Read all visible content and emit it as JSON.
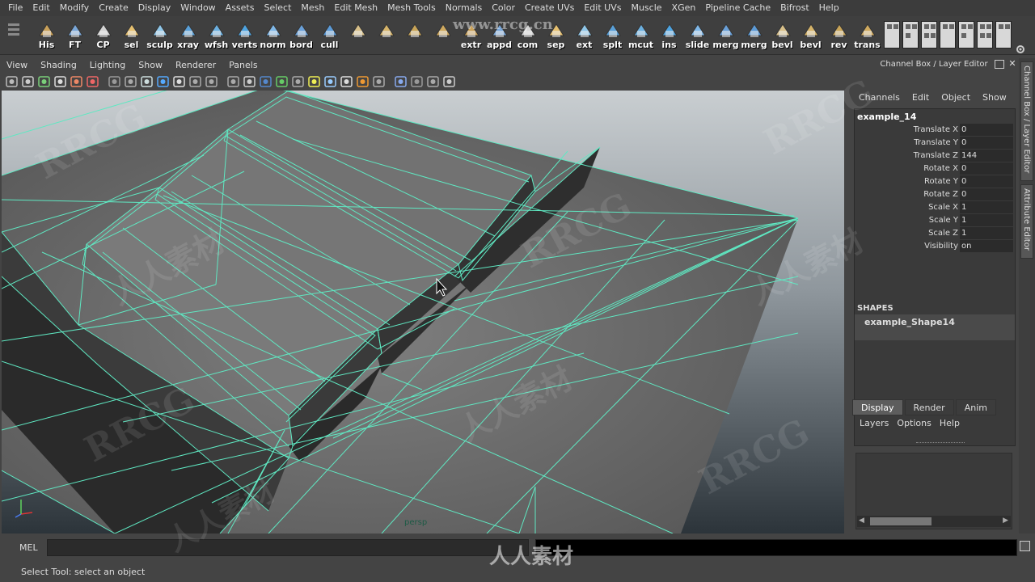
{
  "menubar": [
    "File",
    "Edit",
    "Modify",
    "Create",
    "Display",
    "Window",
    "Assets",
    "Select",
    "Mesh",
    "Edit Mesh",
    "Mesh Tools",
    "Normals",
    "Color",
    "Create UVs",
    "Edit UVs",
    "Muscle",
    "XGen",
    "Pipeline Cache",
    "Bifrost",
    "Help"
  ],
  "shelf": {
    "tools": [
      {
        "label": "His",
        "icon": "history-icon"
      },
      {
        "label": "FT",
        "icon": "freeze-transform-icon"
      },
      {
        "label": "CP",
        "icon": "center-pivot-icon"
      },
      {
        "label": "sel",
        "icon": "select-icon"
      },
      {
        "label": "sculp",
        "icon": "sculpt-icon"
      },
      {
        "label": "xray",
        "icon": "xray-icon"
      },
      {
        "label": "wfsh",
        "icon": "wireframe-shaded-icon"
      },
      {
        "label": "verts",
        "icon": "vertices-icon"
      },
      {
        "label": "norm",
        "icon": "normals-icon"
      },
      {
        "label": "bord",
        "icon": "border-edges-icon"
      },
      {
        "label": "cull",
        "icon": "backface-cull-icon"
      },
      {
        "label": "",
        "icon": "poly-plane-icon"
      },
      {
        "label": "",
        "icon": "poly-cube-icon"
      },
      {
        "label": "",
        "icon": "poly-sphere-icon"
      },
      {
        "label": "",
        "icon": "poly-cylinder-icon"
      },
      {
        "label": "extr",
        "icon": "extrude-icon"
      },
      {
        "label": "appd",
        "icon": "append-icon"
      },
      {
        "label": "com",
        "icon": "combine-icon"
      },
      {
        "label": "sep",
        "icon": "separate-icon"
      },
      {
        "label": "ext",
        "icon": "extract-icon"
      },
      {
        "label": "splt",
        "icon": "split-icon"
      },
      {
        "label": "mcut",
        "icon": "multi-cut-icon"
      },
      {
        "label": "ins",
        "icon": "insert-loop-icon"
      },
      {
        "label": "slide",
        "icon": "slide-edge-icon"
      },
      {
        "label": "merg",
        "icon": "merge-icon"
      },
      {
        "label": "merg",
        "icon": "merge-to-center-icon"
      },
      {
        "label": "bevl",
        "icon": "bevel-icon"
      },
      {
        "label": "bevl",
        "icon": "bevel-plus-icon"
      },
      {
        "label": "rev",
        "icon": "reverse-normals-icon"
      },
      {
        "label": "trans",
        "icon": "transfer-icon"
      }
    ],
    "layout_buttons": [
      "single-pane-icon",
      "four-pane-icon",
      "two-pane-side-icon",
      "two-pane-stacked-icon",
      "three-pane-icon",
      "outliner-pane-icon",
      "persp-outliner-icon"
    ],
    "gear_icon": "gear-icon"
  },
  "viewport": {
    "menu": [
      "View",
      "Shading",
      "Lighting",
      "Show",
      "Renderer",
      "Panels"
    ],
    "toolbar_icons": [
      "select-camera-icon",
      "camera-attrs-icon",
      "bookmark-icon",
      "image-plane-icon",
      "2d-pan-icon",
      "grease-pencil-icon",
      "grid-icon",
      "film-gate-icon",
      "resolution-gate-icon",
      "gate-mask-icon",
      "field-chart-icon",
      "safe-action-icon",
      "safe-title-icon",
      "wireframe-icon",
      "smooth-shade-icon",
      "wireframe-on-shaded-icon",
      "textured-icon",
      "lights-icon",
      "shadows-icon",
      "ambient-occlusion-icon",
      "motion-blur-icon",
      "anti-alias-icon",
      "depth-of-field-icon",
      "isolate-select-icon",
      "xray-joints-icon",
      "xray-components-icon",
      "backface-icon"
    ],
    "camera_label": "persp",
    "wire_color": "#5fe8c2"
  },
  "channel_box": {
    "title": "Channel Box / Layer Editor",
    "menu": [
      "Channels",
      "Edit",
      "Object",
      "Show"
    ],
    "object_name": "example_14",
    "attributes": [
      {
        "name": "Translate X",
        "value": "0"
      },
      {
        "name": "Translate Y",
        "value": "0"
      },
      {
        "name": "Translate Z",
        "value": "144"
      },
      {
        "name": "Rotate X",
        "value": "0"
      },
      {
        "name": "Rotate Y",
        "value": "0"
      },
      {
        "name": "Rotate Z",
        "value": "0"
      },
      {
        "name": "Scale X",
        "value": "1"
      },
      {
        "name": "Scale Y",
        "value": "1"
      },
      {
        "name": "Scale Z",
        "value": "1"
      },
      {
        "name": "Visibility",
        "value": "on"
      }
    ],
    "shapes_header": "SHAPES",
    "shape_name": "example_Shape14"
  },
  "layer_editor": {
    "tabs": [
      "Display",
      "Render",
      "Anim"
    ],
    "active_tab": "Display",
    "menu": [
      "Layers",
      "Options",
      "Help"
    ]
  },
  "side_tabs": [
    "Channel Box / Layer Editor",
    "Attribute Editor"
  ],
  "command_line": {
    "label": "MEL",
    "value": ""
  },
  "help_line": "Select Tool: select an object",
  "watermarks": [
    "RRCG",
    "人人素材",
    "www.rrcg.cn"
  ]
}
